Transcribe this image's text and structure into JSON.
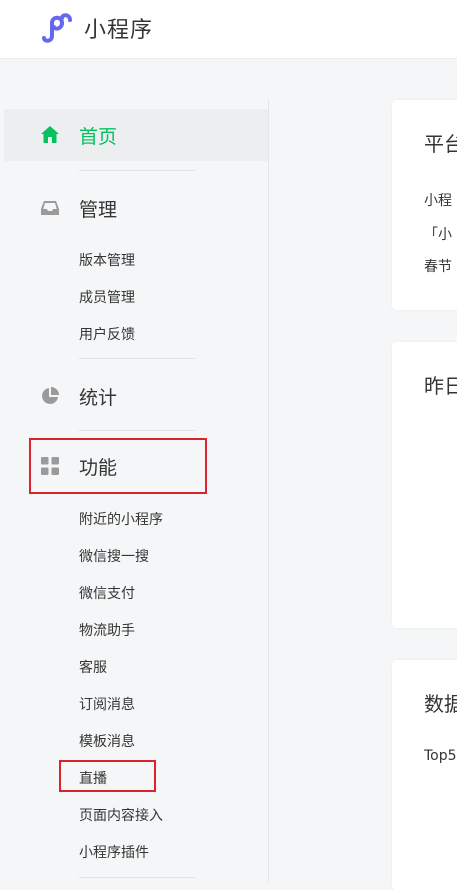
{
  "header": {
    "app_title": "小程序",
    "logo_icon": "mini-program-logo-icon",
    "logo_color": "#6467f0"
  },
  "sidebar": {
    "accent_color": "#07c160",
    "highlight_color": "#d9232d",
    "home": {
      "label": "首页",
      "icon": "home-icon"
    },
    "manage": {
      "label": "管理",
      "icon": "inbox-icon",
      "items": [
        "版本管理",
        "成员管理",
        "用户反馈"
      ]
    },
    "stats": {
      "label": "统计",
      "icon": "pie-chart-icon"
    },
    "features": {
      "label": "功能",
      "icon": "grid-icon",
      "items": [
        "附近的小程序",
        "微信搜一搜",
        "微信支付",
        "物流助手",
        "客服",
        "订阅消息",
        "模板消息",
        "直播",
        "页面内容接入",
        "小程序插件"
      ]
    }
  },
  "main": {
    "card1": {
      "title": "平台",
      "lines": [
        "小程",
        "「小",
        "春节"
      ]
    },
    "card2": {
      "title": "昨日"
    },
    "card3": {
      "title": "数据",
      "line": "Top5"
    }
  }
}
